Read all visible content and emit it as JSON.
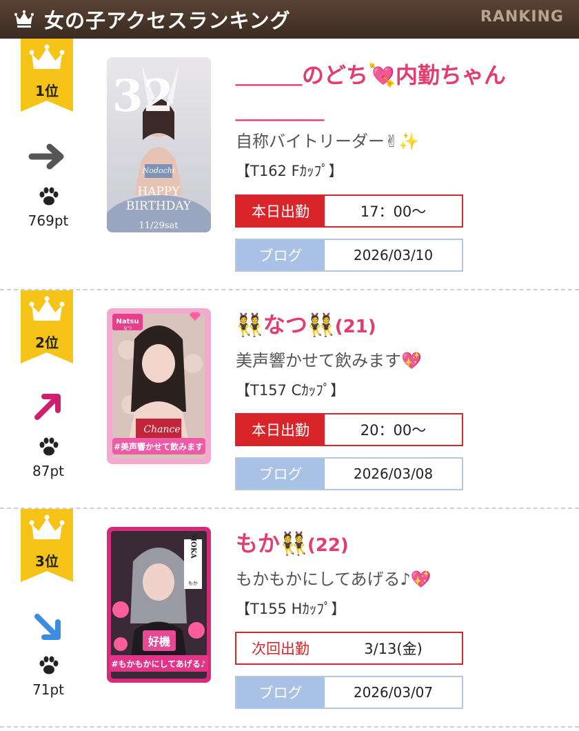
{
  "header": {
    "title": "女の子アクセスランキング",
    "sub": "RANKING"
  },
  "colors": {
    "header_bg": "#4a3629",
    "ribbon": "#f6c417",
    "name": "#e23d6e",
    "work_label": "#d9252a",
    "blog_label": "#a9c1e4"
  },
  "entries": [
    {
      "rank": "1位",
      "trend": "right-arrow",
      "points": "769pt",
      "name": "＿＿＿のどち💘内勤ちゃん",
      "name_line2": "＿＿＿＿",
      "catch": "自称バイトリーダー✌✨",
      "spec": "【T162 Fｶｯﾌﾟ】",
      "work_label": "本日出勤",
      "work_value": "17：00〜",
      "blog_label": "ブログ",
      "blog_value": "2026/03/10",
      "photo_text": {
        "number": "32",
        "line1": "Nodochi",
        "line2": "HAPPY",
        "line3": "BIRTHDAY",
        "date": "11/29sat"
      }
    },
    {
      "rank": "2位",
      "trend": "up-right-arrow",
      "points": "87pt",
      "name": "👯なつ👯",
      "age": "(21)",
      "catch": "美声響かせて飲みます💖",
      "spec": "【T157 Cｶｯﾌﾟ】",
      "work_label": "本日出勤",
      "work_value": "20：00〜",
      "blog_label": "ブログ",
      "blog_value": "2026/03/08",
      "photo_text": {
        "tag": "Natsu",
        "tag_sub": "なつ",
        "brand": "Chance",
        "caption": "#美声響かせて飲みます"
      }
    },
    {
      "rank": "3位",
      "trend": "down-right-arrow",
      "points": "71pt",
      "name": "もか👯",
      "age": "(22)",
      "catch": "もかもかにしてあげる♪💖",
      "spec": "【T155 Hｶｯﾌﾟ】",
      "work_label": "次回出勤",
      "work_value": "3/13(金)",
      "blog_label": "ブログ",
      "blog_value": "2026/03/07",
      "photo_text": {
        "tag": "MOKA",
        "tag_sub": "もか",
        "badge": "好機",
        "caption": "#もかもかにしてあげる♪"
      }
    }
  ]
}
